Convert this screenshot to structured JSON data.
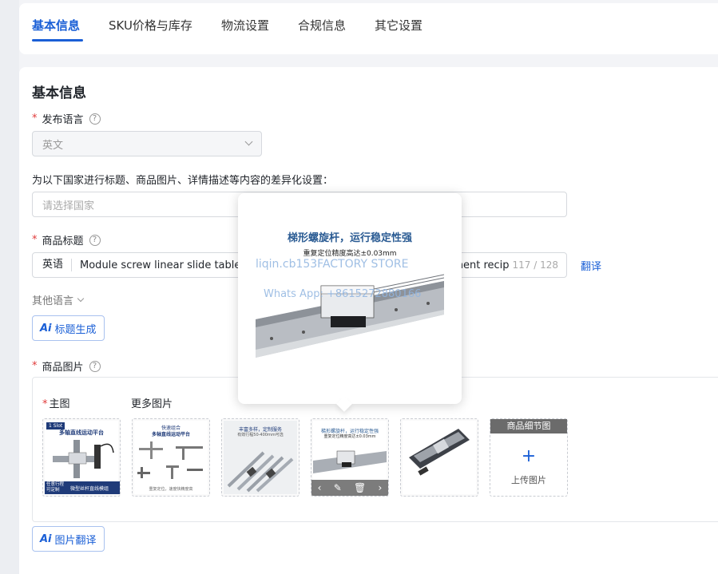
{
  "tabs": [
    {
      "label": "基本信息",
      "active": true
    },
    {
      "label": "SKU价格与库存",
      "active": false
    },
    {
      "label": "物流设置",
      "active": false
    },
    {
      "label": "合规信息",
      "active": false
    },
    {
      "label": "其它设置",
      "active": false
    }
  ],
  "section_title": "基本信息",
  "publish_language": {
    "required_mark": "*",
    "label": "发布语言",
    "value": "英文"
  },
  "country_setting": {
    "label": "为以下国家进行标题、商品图片、详情描述等内容的差异化设置：",
    "placeholder": "请选择国家"
  },
  "product_title": {
    "required_mark": "*",
    "label": "商品标题",
    "language": "英语",
    "value": "Module screw linear slide table g",
    "tail_text": "ment recip",
    "counter": "117 / 128",
    "translate_label": "翻译"
  },
  "other_language_label": "其他语言",
  "ai_title_button": {
    "ai": "Ai",
    "label": "标题生成"
  },
  "product_images": {
    "required_mark": "*",
    "label": "商品图片",
    "main_label": "主图",
    "more_label": "更多图片",
    "upload_header": "商品细节图",
    "upload_label": "上传图片",
    "tool_icons": [
      "‹",
      "✎",
      "🗑",
      "›"
    ]
  },
  "ai_image_button": {
    "ai": "Ai",
    "label": "图片翻译"
  },
  "preview": {
    "title": "梯形螺旋杆，运行稳定性强",
    "subtitle": "重复定位精度高达±0.03mm",
    "watermark_1": "liqin.cb153FACTORY STORE",
    "watermark_2": "Whats App: +8615272880166"
  },
  "thumb1": {
    "badge": "1 Slot",
    "title": "多轴直线运动平台",
    "footer_left": "任意行程 可定制",
    "footer_right": "微型丝杆直线模组"
  },
  "thumb2": {
    "title": "快速组合",
    "subtitle": "多轴直线运动平台",
    "footer": "重复定位，速度快精度高"
  },
  "thumb3": {
    "title": "丰富多样，定制服务",
    "subtitle": "有效行程50-400mm可选"
  },
  "thumb4": {
    "title": "梯形螺旋杆，运行稳定性强",
    "subtitle": "重复定位精度高达±0.03mm"
  },
  "colors": {
    "accent": "#1a5fd6",
    "required": "#e03a3a"
  }
}
